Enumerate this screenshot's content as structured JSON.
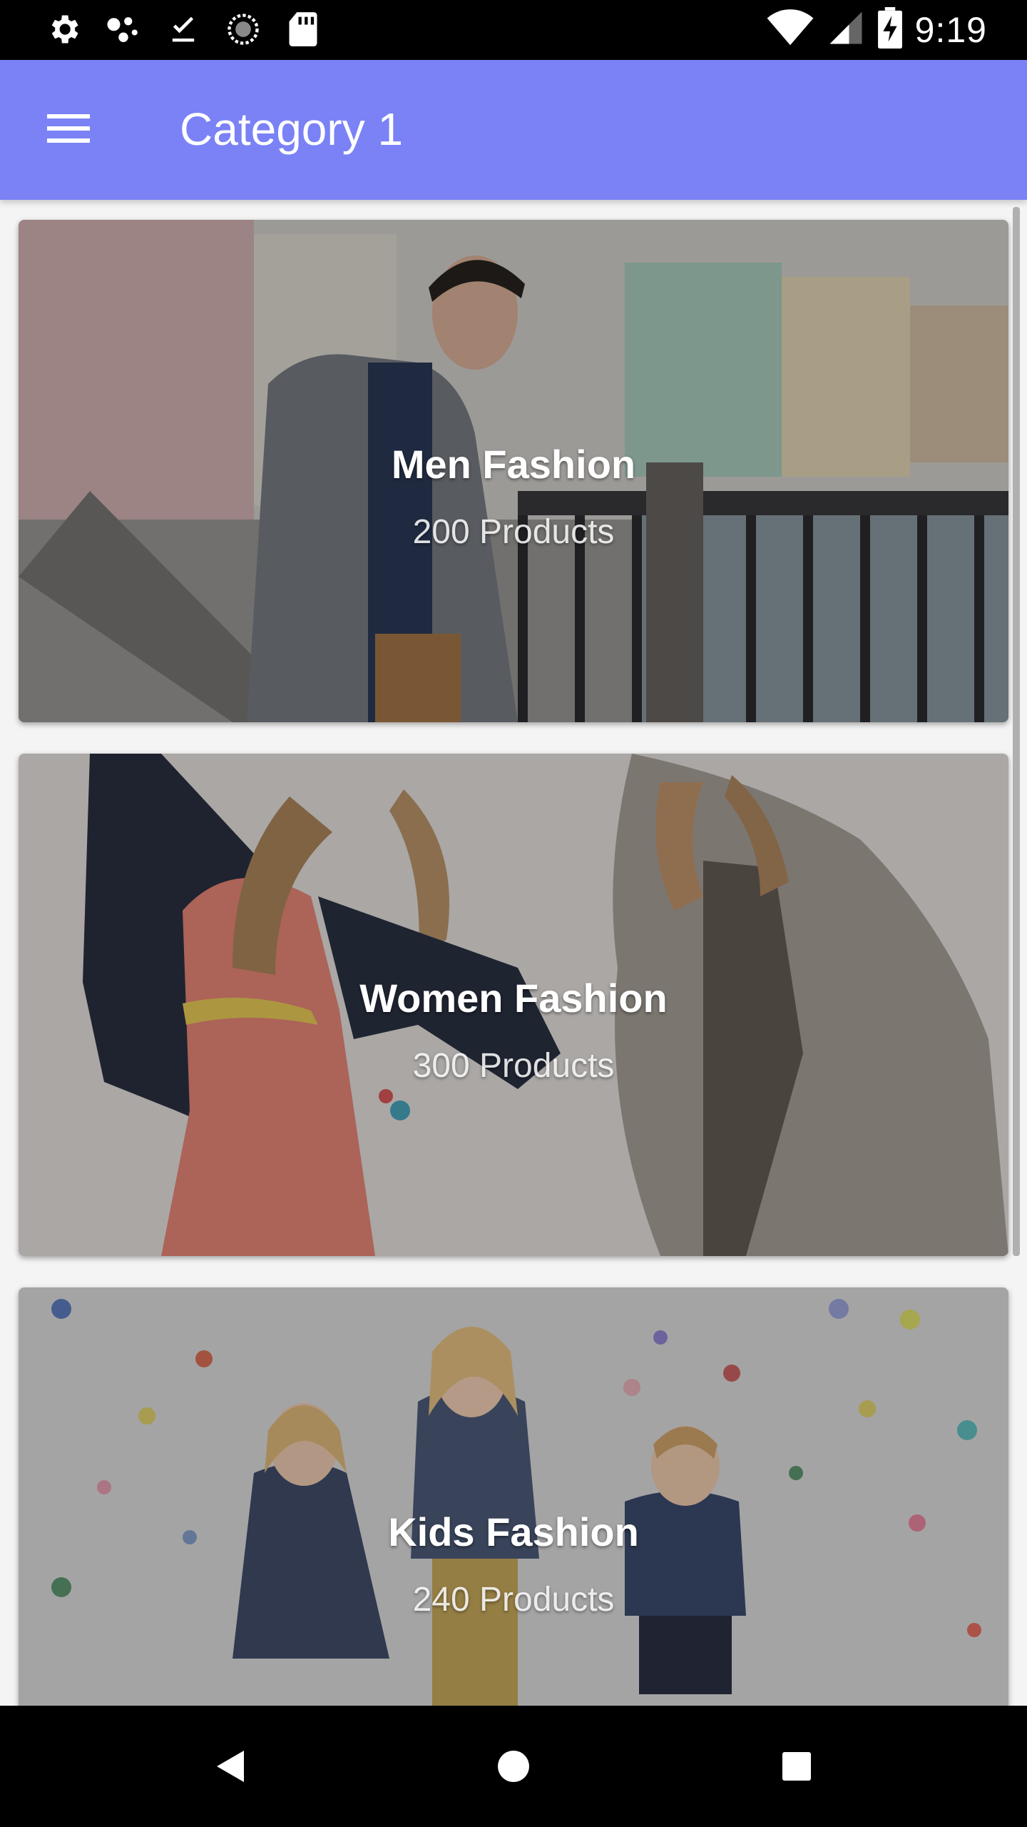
{
  "status_bar": {
    "time": "9:19",
    "icons_left": [
      "settings-icon",
      "assistant-dots-icon",
      "download-done-icon",
      "sync-icon",
      "sd-card-icon"
    ],
    "icons_right": [
      "wifi-icon",
      "cell-signal-icon",
      "battery-charging-icon"
    ]
  },
  "app_bar": {
    "title": "Category 1",
    "color": "#7a82f5"
  },
  "categories": [
    {
      "title": "Men Fashion",
      "count": "200 Products"
    },
    {
      "title": "Women Fashion",
      "count": "300 Products"
    },
    {
      "title": "Kids Fashion",
      "count": "240 Products"
    }
  ],
  "nav_bar": {
    "buttons": [
      "back-icon",
      "home-icon",
      "recents-icon"
    ]
  }
}
